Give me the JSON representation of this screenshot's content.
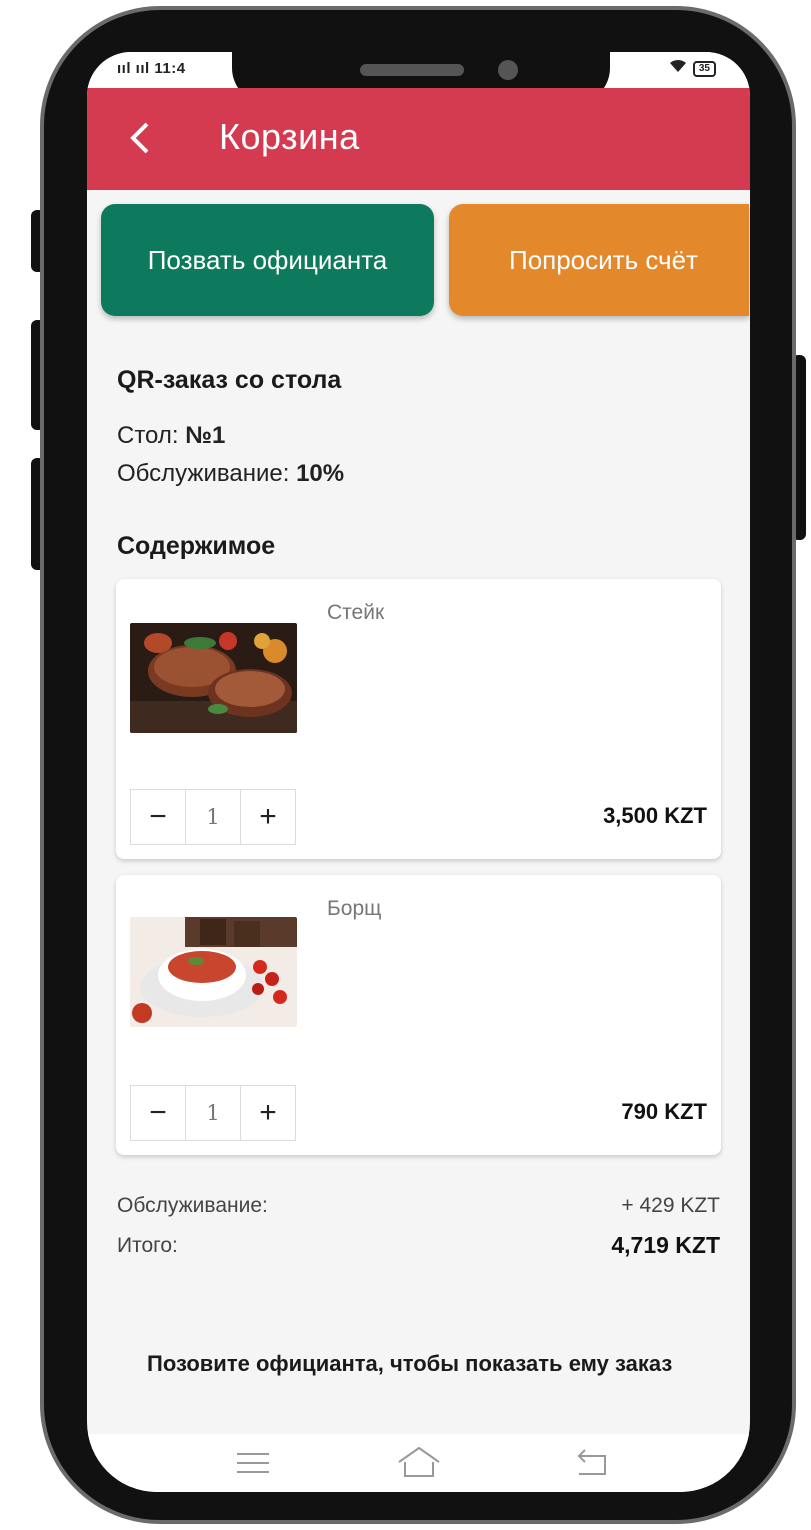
{
  "status_bar": {
    "time": "11:4",
    "signal": "ııl ııl",
    "battery": "35"
  },
  "header": {
    "title": "Корзина"
  },
  "actions": {
    "call_waiter": "Позвать официанта",
    "request_bill": "Попросить счёт"
  },
  "order": {
    "heading": "QR-заказ со стола",
    "table_label": "Стол:",
    "table_value": "№1",
    "service_label": "Обслуживание:",
    "service_value": "10%"
  },
  "contents": {
    "heading": "Содержимое",
    "items": [
      {
        "name": "Стейк",
        "qty": "1",
        "price": "3,500 KZT"
      },
      {
        "name": "Борщ",
        "qty": "1",
        "price": "790 KZT"
      }
    ]
  },
  "stepper": {
    "minus": "−",
    "plus": "+"
  },
  "totals": {
    "service_label": "Обслуживание:",
    "service_value": "+ 429 KZT",
    "total_label": "Итого:",
    "total_value": "4,719 KZT"
  },
  "note": "Позовите официанта, чтобы показать ему заказ",
  "colors": {
    "header": "#d43a50",
    "call_button": "#0e7a5d",
    "bill_button": "#e3892b"
  }
}
